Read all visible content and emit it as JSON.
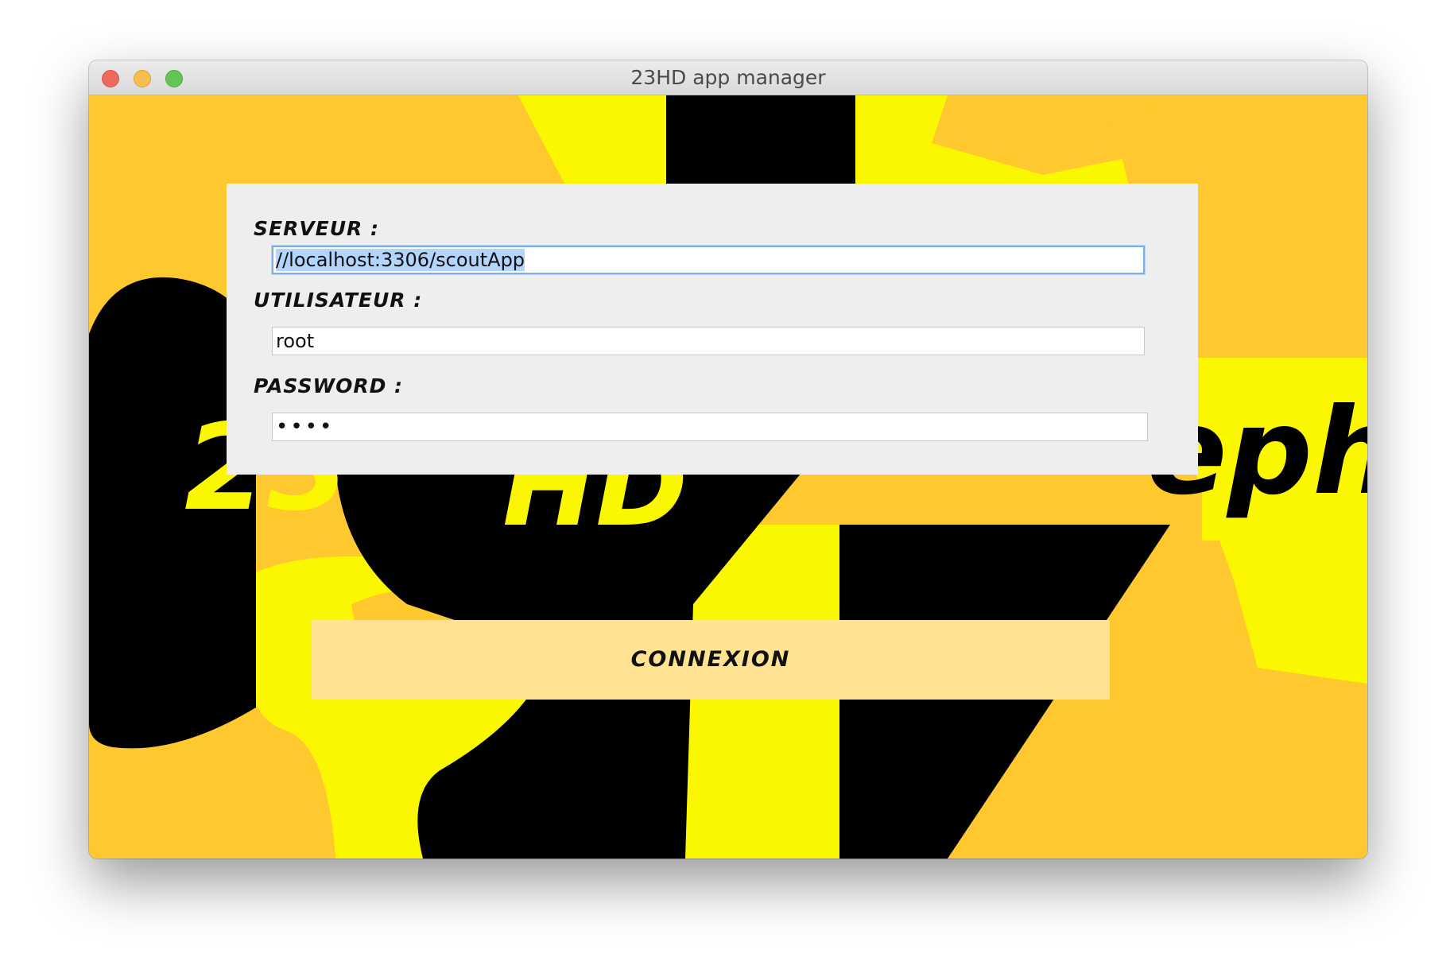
{
  "window": {
    "title": "23HD app manager"
  },
  "background": {
    "text_left_1": "23",
    "text_left_2": "HD",
    "text_right": "eph",
    "colors": {
      "orange": "#ffc82e",
      "yellow": "#faf700",
      "black": "#000000"
    }
  },
  "login": {
    "server": {
      "label": "SERVEUR :",
      "value": "//localhost:3306/scoutApp"
    },
    "user": {
      "label": "UTILISATEUR :",
      "value": "root"
    },
    "password": {
      "label": "PASSWORD :",
      "value": "••••"
    },
    "connect_label": "CONNEXION"
  },
  "colors": {
    "panel": "#eeeeee",
    "button": "#ffe393",
    "focus_ring": "#7eaee6",
    "selection": "#b3d4fc"
  }
}
